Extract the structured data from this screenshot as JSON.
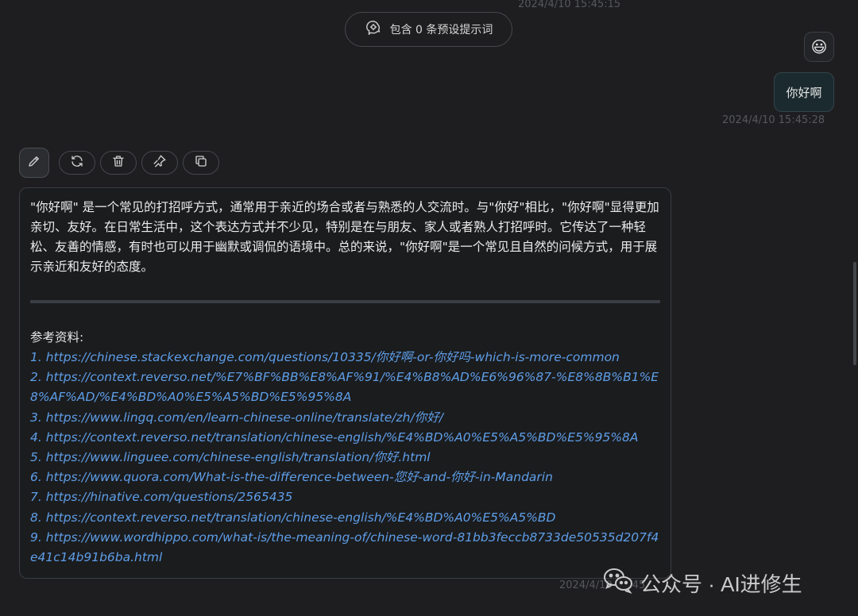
{
  "timestamps": {
    "top": "2024/4/10 15:45:15",
    "user": "2024/4/10 15:45:28",
    "bottom": "2024/4/10 15:45"
  },
  "prompt_pill": {
    "label": "包含 0 条预设提示词",
    "icon": "brain-icon"
  },
  "user_message": {
    "avatar": "😃",
    "text": "你好啊"
  },
  "actions": {
    "icons": [
      "edit-icon",
      "refresh-icon",
      "delete-icon",
      "pin-icon",
      "copy-icon"
    ]
  },
  "answer": {
    "body": "\"你好啊\" 是一个常见的打招呼方式，通常用于亲近的场合或者与熟悉的人交流时。与\"你好\"相比，\"你好啊\"显得更加亲切、友好。在日常生活中，这个表达方式并不少见，特别是在与朋友、家人或者熟人打招呼时。它传达了一种轻松、友善的情感，有时也可以用于幽默或调侃的语境中。总的来说，\"你好啊\"是一个常见且自然的问候方式，用于展示亲近和友好的态度。",
    "references_title": "参考资料:",
    "references": [
      "1. https://chinese.stackexchange.com/questions/10335/你好啊-or-你好吗-which-is-more-common",
      "2. https://context.reverso.net/%E7%BF%BB%E8%AF%91/%E4%B8%AD%E6%96%87-%E8%8B%B1%E8%AF%AD/%E4%BD%A0%E5%A5%BD%E5%95%8A",
      "3. https://www.lingq.com/en/learn-chinese-online/translate/zh/你好/",
      "4. https://context.reverso.net/translation/chinese-english/%E4%BD%A0%E5%A5%BD%E5%95%8A",
      "5. https://www.linguee.com/chinese-english/translation/你好.html",
      "6. https://www.quora.com/What-is-the-difference-between-您好-and-你好-in-Mandarin",
      "7. https://hinative.com/questions/2565435",
      "8. https://context.reverso.net/translation/chinese-english/%E4%BD%A0%E5%A5%BD",
      "9. https://www.wordhippo.com/what-is/the-meaning-of/chinese-word-81bb3feccb8733de50535d207f4e41c14b91b6ba.html"
    ]
  },
  "watermark": {
    "text": "公众号 · AI进修生",
    "icon": "wechat-icon"
  },
  "colors": {
    "background": "#1e1e20",
    "link": "#5e9ee8",
    "user_bubble": "#1b2a2e"
  }
}
